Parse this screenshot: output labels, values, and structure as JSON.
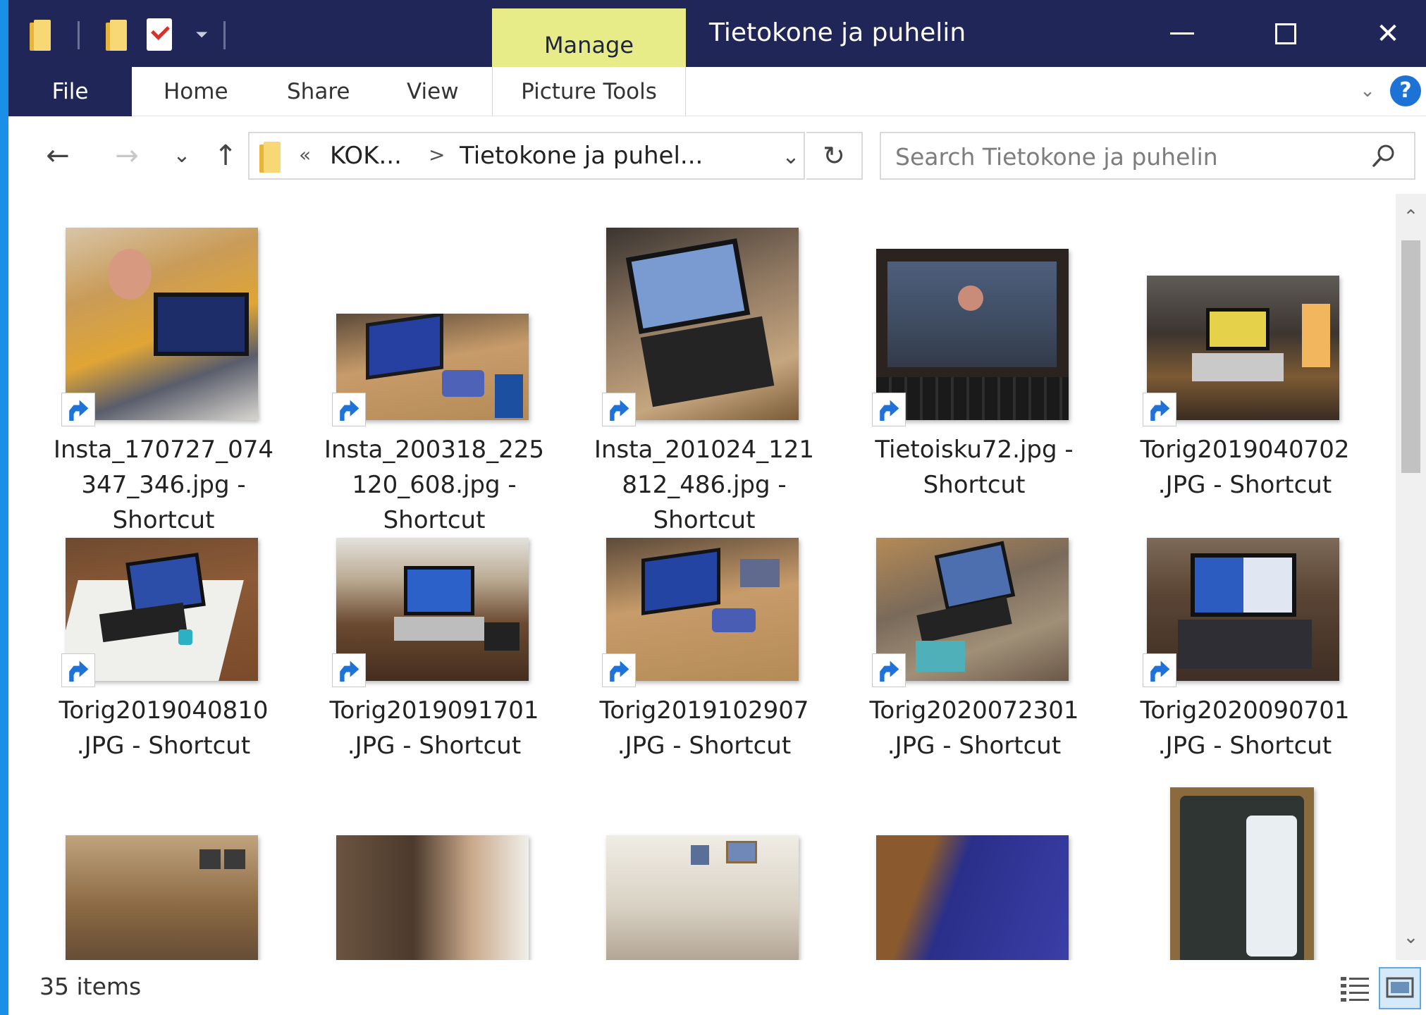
{
  "window": {
    "title": "Tietokone ja puhelin",
    "manage_tab": "Manage",
    "minimize_glyph": "—",
    "close_glyph": "✕"
  },
  "ribbon": {
    "tabs": {
      "file": "File",
      "home": "Home",
      "share": "Share",
      "view": "View",
      "picture_tools": "Picture Tools"
    },
    "help_glyph": "?"
  },
  "address": {
    "overflow": "«",
    "crumbs": [
      "KOK...",
      "Tietokone ja puhel..."
    ],
    "separator": ">"
  },
  "search": {
    "placeholder": "Search Tietokone ja puhelin"
  },
  "items": [
    {
      "label": "Insta_170727_074\n347_346.jpg -\nShortcut",
      "icon": "shortcut-overlay-icon"
    },
    {
      "label": "Insta_200318_225\n120_608.jpg -\nShortcut",
      "icon": "shortcut-overlay-icon"
    },
    {
      "label": "Insta_201024_121\n812_486.jpg -\nShortcut",
      "icon": "shortcut-overlay-icon"
    },
    {
      "label": "Tietoisku72.jpg -\nShortcut",
      "icon": "shortcut-overlay-icon"
    },
    {
      "label": "Torig2019040702\n.JPG - Shortcut",
      "icon": "shortcut-overlay-icon"
    },
    {
      "label": "Torig2019040810\n.JPG - Shortcut",
      "icon": "shortcut-overlay-icon"
    },
    {
      "label": "Torig2019091701\n.JPG - Shortcut",
      "icon": "shortcut-overlay-icon"
    },
    {
      "label": "Torig2019102907\n.JPG - Shortcut",
      "icon": "shortcut-overlay-icon"
    },
    {
      "label": "Torig2020072301\n.JPG - Shortcut",
      "icon": "shortcut-overlay-icon"
    },
    {
      "label": "Torig2020090701\n.JPG - Shortcut",
      "icon": "shortcut-overlay-icon"
    }
  ],
  "status": {
    "item_count": "35 items"
  },
  "colors": {
    "titlebar": "#202658",
    "manage_accent": "#e8ec88",
    "shortcut_arrow": "#1f72d8",
    "desktop": "#1a8fe8"
  }
}
